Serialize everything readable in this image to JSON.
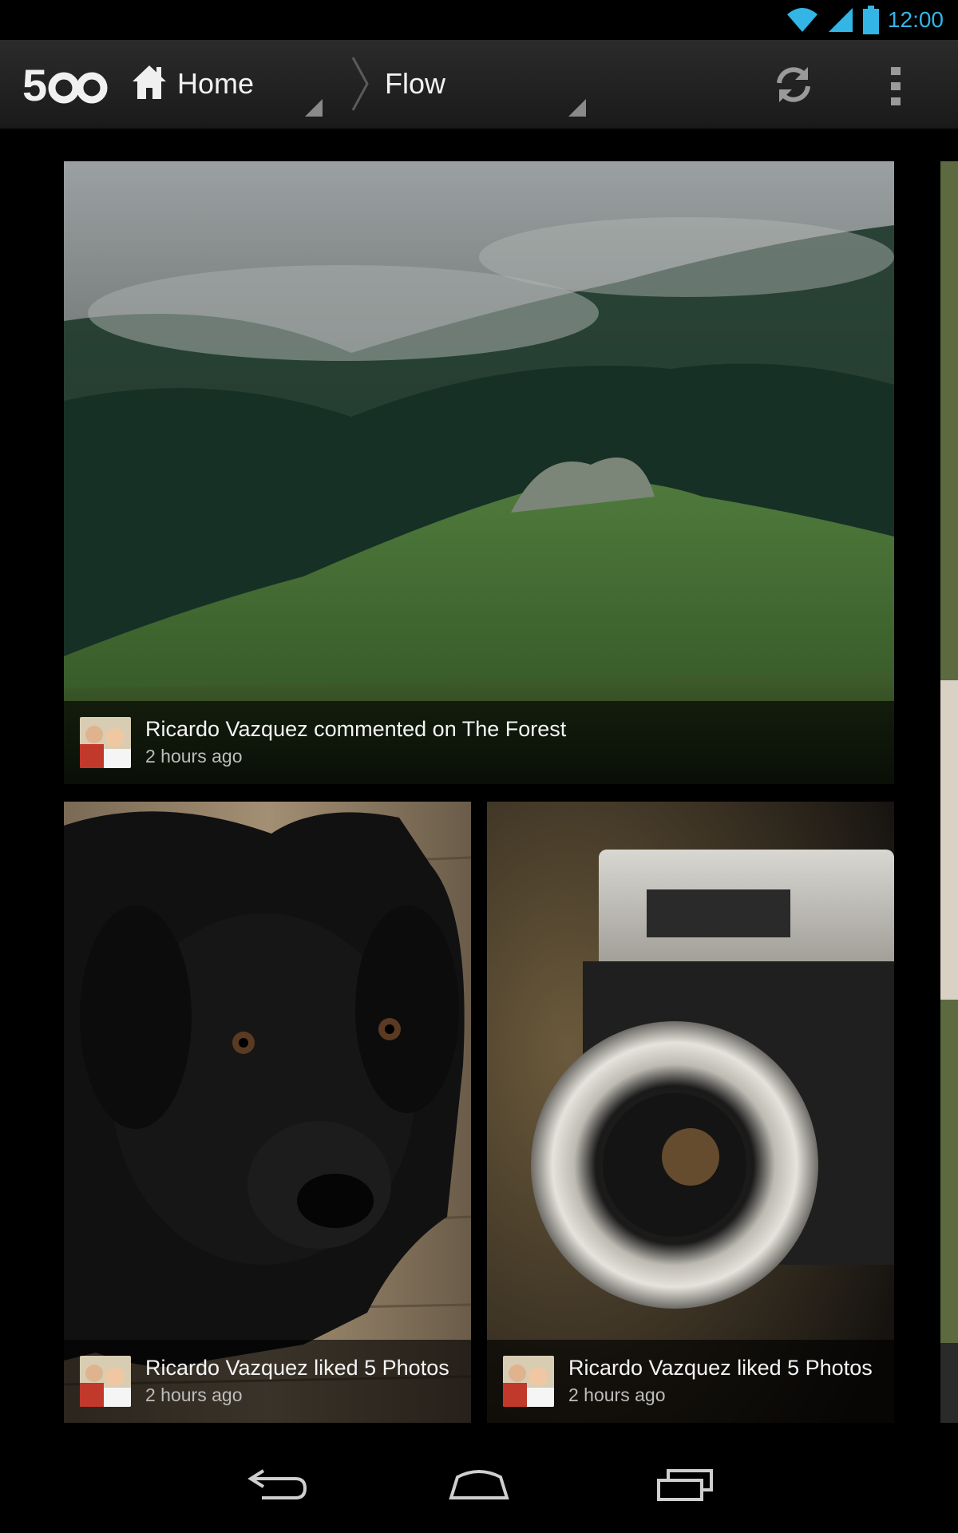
{
  "status_bar": {
    "time": "12:00",
    "wifi_icon": "wifi-icon",
    "signal_icon": "signal-icon",
    "battery_icon": "battery-icon",
    "accent": "#33b5e5"
  },
  "action_bar": {
    "logo_icon": "500px-logo-icon",
    "home_label": "Home",
    "flow_label": "Flow",
    "refresh_icon": "refresh-icon",
    "overflow_icon": "overflow-menu-icon"
  },
  "feed": [
    {
      "title": "Ricardo Vazquez commented on The Forest",
      "time": "2 hours ago",
      "photo": "misty-forest-hillside"
    },
    {
      "title": "Ricardo Vazquez liked 5 Photos",
      "time": "2 hours ago",
      "photo": "black-labrador-puppy"
    },
    {
      "title": "Ricardo Vazquez liked 5 Photos",
      "time": "2 hours ago",
      "photo": "vintage-zeiss-ikon-camera"
    }
  ],
  "nav_bar": {
    "back_icon": "back-icon",
    "home_icon": "home-nav-icon",
    "recents_icon": "recent-apps-icon"
  }
}
